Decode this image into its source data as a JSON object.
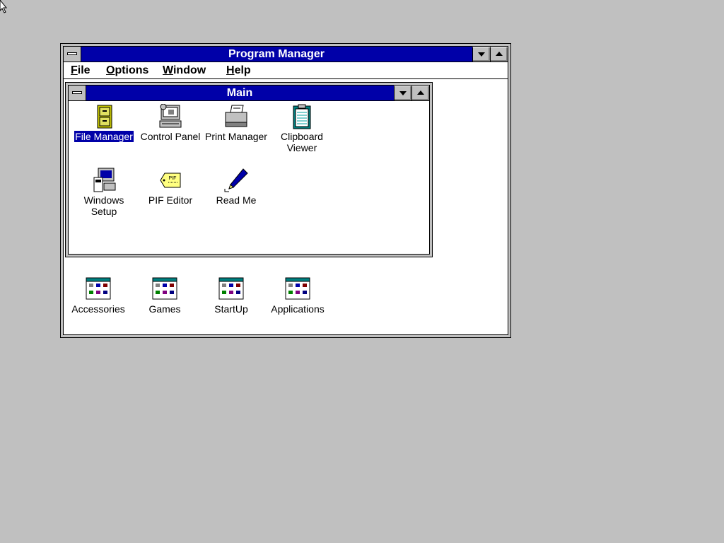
{
  "program_manager": {
    "title": "Program Manager",
    "menu": [
      {
        "accel": "F",
        "rest": "ile"
      },
      {
        "accel": "O",
        "rest": "ptions"
      },
      {
        "accel": "W",
        "rest": "indow"
      },
      {
        "accel": "H",
        "rest": "elp"
      }
    ]
  },
  "main_group": {
    "title": "Main",
    "icons": [
      {
        "label": "File Manager",
        "icon": "file-cabinet-icon",
        "selected": true
      },
      {
        "label": "Control Panel",
        "icon": "control-panel-icon"
      },
      {
        "label": "Print Manager",
        "icon": "printer-icon"
      },
      {
        "label": "Clipboard\nViewer",
        "icon": "clipboard-icon"
      },
      {
        "label": "Windows\nSetup",
        "icon": "setup-computer-icon"
      },
      {
        "label": "PIF Editor",
        "icon": "pif-tag-icon"
      },
      {
        "label": "Read Me",
        "icon": "pen-icon"
      }
    ]
  },
  "minimized_groups": [
    {
      "label": "Accessories",
      "icon": "program-group-icon"
    },
    {
      "label": "Games",
      "icon": "program-group-icon"
    },
    {
      "label": "StartUp",
      "icon": "program-group-icon"
    },
    {
      "label": "Applications",
      "icon": "program-group-icon"
    }
  ],
  "colors": {
    "titlebar": "#0000a8",
    "desktop": "#c0c0c0",
    "window": "#ffffff"
  }
}
